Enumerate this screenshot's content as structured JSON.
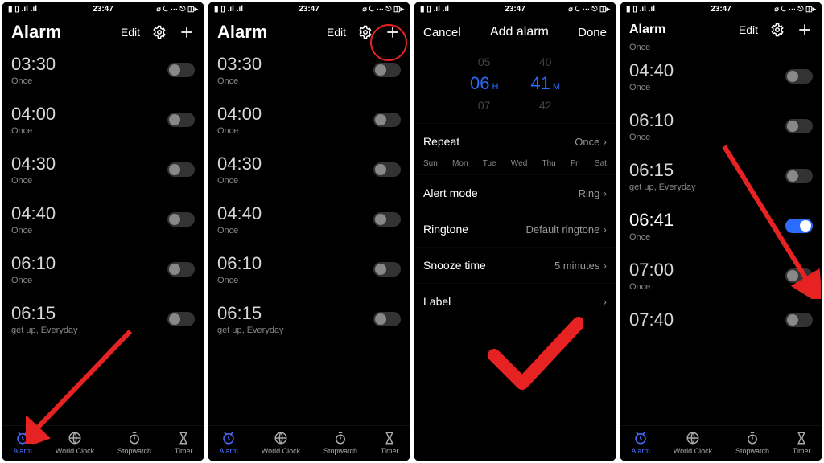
{
  "statusbar": {
    "time": "23:47",
    "icons_left": "▮ ▯ .ıl .ıl",
    "icons_right": "⌀ ⏾ ⋯ ⎋ ◫▸"
  },
  "header": {
    "title": "Alarm",
    "edit": "Edit"
  },
  "nav": {
    "items": [
      {
        "label": "Alarm"
      },
      {
        "label": "World Clock"
      },
      {
        "label": "Stopwatch"
      },
      {
        "label": "Timer"
      }
    ]
  },
  "panel1": {
    "alarms": [
      {
        "time": "03:30",
        "sub": "Once"
      },
      {
        "time": "04:00",
        "sub": "Once"
      },
      {
        "time": "04:30",
        "sub": "Once"
      },
      {
        "time": "04:40",
        "sub": "Once"
      },
      {
        "time": "06:10",
        "sub": "Once"
      },
      {
        "time": "06:15",
        "sub": "get up,  Everyday"
      }
    ]
  },
  "panel2": {
    "alarms": [
      {
        "time": "03:30",
        "sub": "Once"
      },
      {
        "time": "04:00",
        "sub": "Once"
      },
      {
        "time": "04:30",
        "sub": "Once"
      },
      {
        "time": "04:40",
        "sub": "Once"
      },
      {
        "time": "06:10",
        "sub": "Once"
      },
      {
        "time": "06:15",
        "sub": "get up,  Everyday"
      }
    ]
  },
  "panel3": {
    "cancel": "Cancel",
    "title": "Add alarm",
    "done": "Done",
    "picker": {
      "h_prev": "05",
      "h_sel": "06",
      "h_unit": "H",
      "h_next": "07",
      "m_prev": "40",
      "m_sel": "41",
      "m_unit": "M",
      "m_next": "42"
    },
    "days": [
      "Sun",
      "Mon",
      "Tue",
      "Wed",
      "Thu",
      "Fri",
      "Sat"
    ],
    "settings": {
      "repeat_label": "Repeat",
      "repeat_val": "Once",
      "alert_label": "Alert mode",
      "alert_val": "Ring",
      "ringtone_label": "Ringtone",
      "ringtone_val": "Default ringtone",
      "snooze_label": "Snooze time",
      "snooze_val": "5 minutes",
      "label_label": "Label",
      "label_val": ""
    }
  },
  "panel4": {
    "once_top": "Once",
    "alarms": [
      {
        "time": "04:40",
        "sub": "Once",
        "on": false
      },
      {
        "time": "06:10",
        "sub": "Once",
        "on": false
      },
      {
        "time": "06:15",
        "sub": "get up,  Everyday",
        "on": false
      },
      {
        "time": "06:41",
        "sub": "Once",
        "on": true
      },
      {
        "time": "07:00",
        "sub": "Once",
        "on": false
      },
      {
        "time": "07:40",
        "sub": "",
        "on": false
      }
    ]
  }
}
